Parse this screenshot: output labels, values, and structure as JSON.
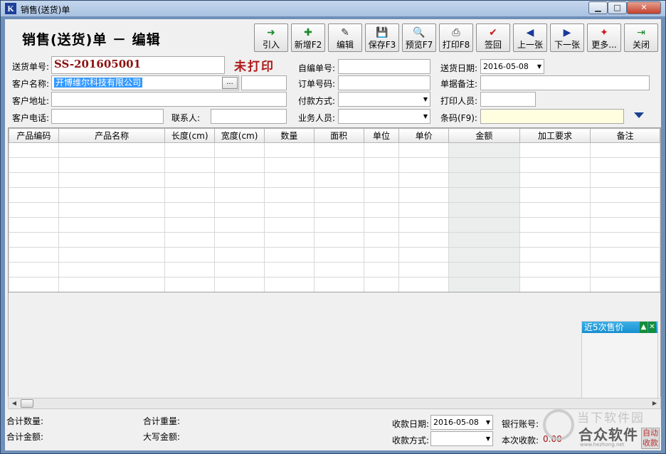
{
  "window": {
    "icon_letter": "K",
    "title": "销售(送货)单",
    "min_glyph": "▁",
    "max_glyph": "□",
    "close_glyph": "✕"
  },
  "header": {
    "page_title": "销售(送货)单 － 编辑"
  },
  "toolbar": [
    {
      "label": "引入",
      "icon": "import-arrow-icon",
      "glyph": "➜"
    },
    {
      "label": "新增F2",
      "icon": "new-document-icon",
      "glyph": "✚"
    },
    {
      "label": "编辑",
      "icon": "edit-document-icon",
      "glyph": "✎"
    },
    {
      "label": "保存F3",
      "icon": "floppy-disk-icon",
      "glyph": "💾"
    },
    {
      "label": "预览F7",
      "icon": "magnifier-icon",
      "glyph": "🔍"
    },
    {
      "label": "打印F8",
      "icon": "printer-icon",
      "glyph": "⎙"
    },
    {
      "label": "签回",
      "icon": "check-mark-icon",
      "glyph": "✔"
    },
    {
      "label": "上一张",
      "icon": "arrow-left-icon",
      "glyph": "◀"
    },
    {
      "label": "下一张",
      "icon": "arrow-right-icon",
      "glyph": "▶"
    },
    {
      "label": "更多...",
      "icon": "more-options-icon",
      "glyph": "✦"
    },
    {
      "label": "关闭",
      "icon": "exit-door-icon",
      "glyph": "⇥"
    }
  ],
  "form": {
    "order_no_label": "送货单号:",
    "order_no": "SS-201605001",
    "print_status": "未打印",
    "self_no_label": "自编单号:",
    "self_no": "",
    "date_label": "送货日期:",
    "date": "2016-05-08",
    "customer_label": "客户名称:",
    "customer": "开博维尔科技有限公司",
    "ellipsis": "...",
    "po_label": "订单号码:",
    "remark_label": "单据备注:",
    "address_label": "客户地址:",
    "payment_label": "付款方式:",
    "printer_label": "打印人员:",
    "phone_label": "客户电话:",
    "contact_label": "联系人:",
    "sales_label": "业务人员:",
    "barcode_label": "条码(F9):"
  },
  "grid": {
    "columns": [
      "产品编码",
      "产品名称",
      "长度(cm)",
      "宽度(cm)",
      "数量",
      "面积",
      "单位",
      "单价",
      "金额",
      "加工要求",
      "备注"
    ],
    "row_count": 10
  },
  "recent_price": {
    "title": "近5次售价",
    "collapse_glyph": "▲",
    "close_glyph": "✕"
  },
  "scroll": {
    "left_glyph": "◀",
    "right_glyph": "▶"
  },
  "footer": {
    "total_qty_label": "合计数量:",
    "total_weight_label": "合计重量:",
    "total_amount_label": "合计金额:",
    "capital_amount_label": "大写金额:",
    "receipt_date_label": "收款日期:",
    "receipt_date": "2016-05-08",
    "bank_label": "银行账号:",
    "receipt_method_label": "收款方式:",
    "this_receipt_label": "本次收款:",
    "this_receipt": "0.00"
  },
  "watermark": {
    "small_text": "当下软件园",
    "big_text": "合众软件",
    "url": "www.hezhong.net",
    "btn_text": "自动收款"
  },
  "colors": {
    "order_no": "#8b1010",
    "print_status": "#b01818",
    "selection": "#3399ff",
    "recent_header": "#178ecf",
    "barcode_bg": "#ffffe0"
  }
}
